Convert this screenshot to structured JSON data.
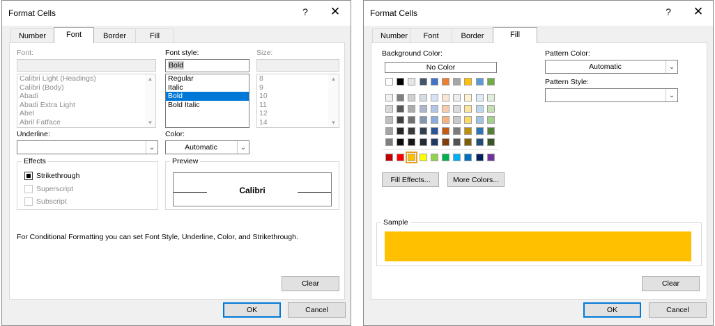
{
  "font_dialog": {
    "title": "Format Cells",
    "help": "?",
    "close": "✕",
    "tabs": [
      "Number",
      "Font",
      "Border",
      "Fill"
    ],
    "font_label": "Font:",
    "font_value": "",
    "font_list": [
      "Calibri Light (Headings)",
      "Calibri (Body)",
      "Abadi",
      "Abadi Extra Light",
      "Abel",
      "Abril Fatface"
    ],
    "style_label": "Font style:",
    "style_value": "Bold",
    "style_list": [
      "Regular",
      "Italic",
      "Bold",
      "Bold Italic"
    ],
    "style_selected": "Bold",
    "size_label": "Size:",
    "size_value": "",
    "size_list": [
      "8",
      "9",
      "10",
      "11",
      "12",
      "14"
    ],
    "underline_label": "Underline:",
    "underline_value": "",
    "color_label": "Color:",
    "color_value": "Automatic",
    "effects_title": "Effects",
    "effects": [
      {
        "label": "Strikethrough",
        "state": "mixed",
        "enabled": true
      },
      {
        "label": "Superscript",
        "state": "unchecked",
        "enabled": false
      },
      {
        "label": "Subscript",
        "state": "unchecked",
        "enabled": false
      }
    ],
    "preview_title": "Preview",
    "preview_text": "Calibri",
    "info_text": "For Conditional Formatting you can set Font Style, Underline, Color, and Strikethrough.",
    "clear_label": "Clear",
    "ok_label": "OK",
    "cancel_label": "Cancel"
  },
  "fill_dialog": {
    "title": "Format Cells",
    "help": "?",
    "close": "✕",
    "tabs": [
      "Number",
      "Font",
      "Border",
      "Fill"
    ],
    "bg_color_label": "Background Color:",
    "no_color_label": "No Color",
    "theme_colors_top": [
      "#ffffff",
      "#000000",
      "#e7e6e6",
      "#44546a",
      "#4472c4",
      "#ed7d31",
      "#a5a5a5",
      "#ffc000",
      "#5b9bd5",
      "#70ad47"
    ],
    "theme_colors_shades": [
      [
        "#f2f2f2",
        "#808080",
        "#d0cece",
        "#d6dce4",
        "#d9e2f3",
        "#fbe5d5",
        "#ededed",
        "#fff2cc",
        "#deebf6",
        "#e2efd9"
      ],
      [
        "#d8d8d8",
        "#595959",
        "#aeabab",
        "#adb9ca",
        "#b4c6e7",
        "#f7cbac",
        "#dbdbdb",
        "#fee599",
        "#bdd7ee",
        "#c5e0b3"
      ],
      [
        "#bfbfbf",
        "#404040",
        "#757070",
        "#8496b0",
        "#8eaadb",
        "#f4b183",
        "#c9c9c9",
        "#ffd966",
        "#9dc3e6",
        "#a8d08d"
      ],
      [
        "#a5a5a5",
        "#262626",
        "#3a3838",
        "#323f4f",
        "#2f5496",
        "#c55a11",
        "#7b7b7b",
        "#bf9000",
        "#2e75b5",
        "#538135"
      ],
      [
        "#7f7f7f",
        "#0d0d0d",
        "#171616",
        "#222a35",
        "#1f3864",
        "#833c0b",
        "#525252",
        "#7f6000",
        "#1f4e79",
        "#375623"
      ]
    ],
    "standard_colors": [
      "#c00000",
      "#ff0000",
      "#ffc000",
      "#ffff00",
      "#92d050",
      "#00b050",
      "#00b0f0",
      "#0070c0",
      "#002060",
      "#7030a0"
    ],
    "selected_standard_index": 2,
    "fill_effects_label": "Fill Effects...",
    "more_colors_label": "More Colors...",
    "pattern_color_label": "Pattern Color:",
    "pattern_color_value": "Automatic",
    "pattern_style_label": "Pattern Style:",
    "pattern_style_value": "",
    "sample_title": "Sample",
    "sample_color": "#ffc000",
    "clear_label": "Clear",
    "ok_label": "OK",
    "cancel_label": "Cancel"
  }
}
